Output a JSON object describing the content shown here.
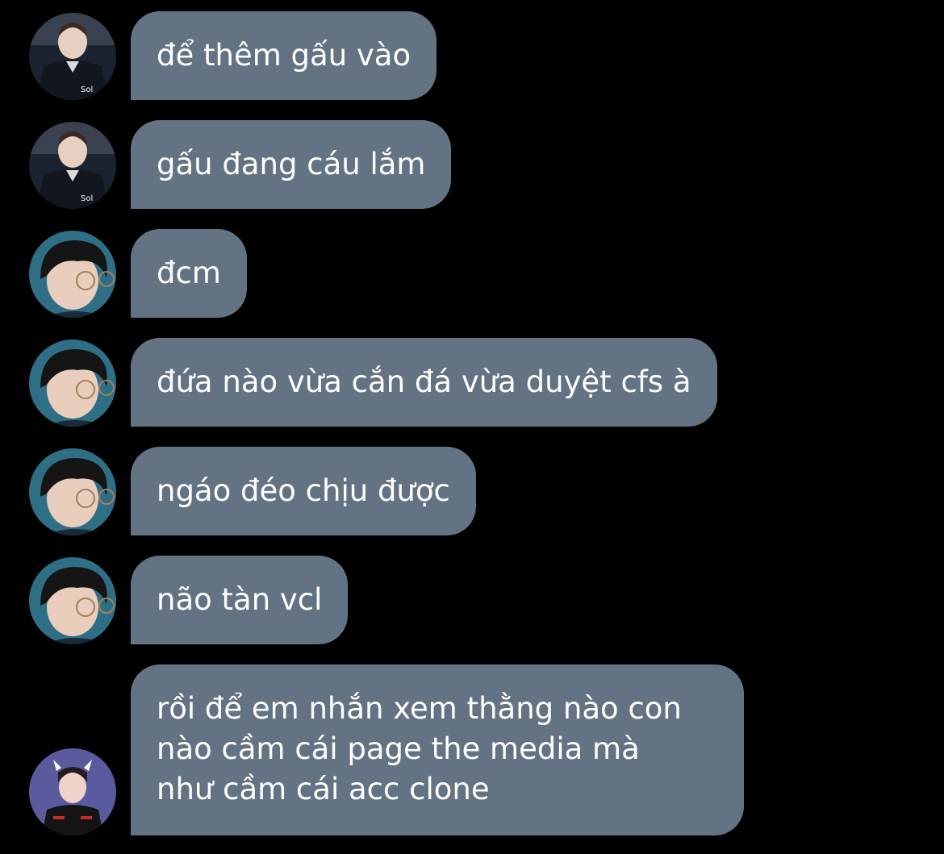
{
  "conversation": {
    "messages": [
      {
        "avatar": "player-portrait-avatar",
        "text": "để thêm gấu vào"
      },
      {
        "avatar": "player-portrait-avatar",
        "text": "gấu đang cáu lắm"
      },
      {
        "avatar": "glasses-boy-avatar",
        "text": "đcm"
      },
      {
        "avatar": "glasses-boy-avatar",
        "text": "đứa nào vừa cắn đá vừa duyệt cfs à"
      },
      {
        "avatar": "glasses-boy-avatar",
        "text": "ngáo đéo chịu được"
      },
      {
        "avatar": "glasses-boy-avatar",
        "text": "não tàn vcl"
      },
      {
        "avatar": "devil-horns-avatar",
        "lines": [
          "rồi để em nhắn xem thằng nào con",
          "nào cầm cái page the media mà",
          "như cầm cái acc clone"
        ]
      }
    ]
  },
  "colors": {
    "background": "#000000",
    "bubble": "#637384",
    "text": "#ffffff"
  }
}
